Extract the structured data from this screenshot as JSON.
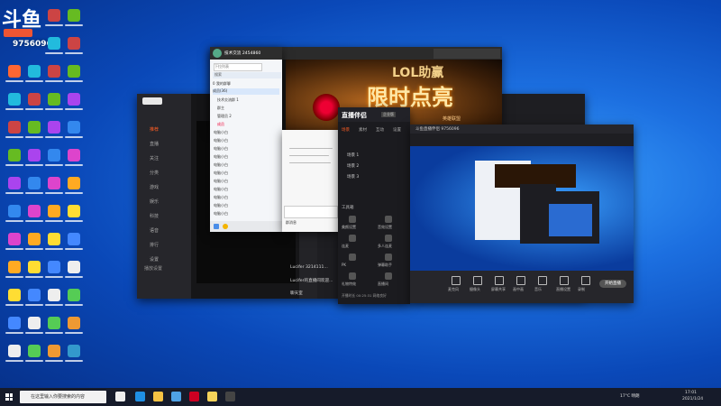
{
  "overlay": {
    "logo": "斗鱼",
    "room_number": "9756096"
  },
  "taskbar": {
    "search_placeholder": "在这里输入你要搜索的内容",
    "weather": "17°C 晴朗",
    "time": "17:01",
    "date": "2021/1/24"
  },
  "qq_window": {
    "title": "技术交流 2454860",
    "collapse": "下拉列表",
    "search_placeholder": "搜索",
    "group_label": "0 我的群聊",
    "members_title": "成员(36)",
    "members": [
      "技术交流群 1",
      "群主",
      "管理员 2",
      "成员",
      "电脑小白",
      "电脑小白",
      "电脑小白",
      "电脑小白",
      "电脑小白",
      "电脑小白",
      "电脑小白",
      "电脑小白",
      "电脑小白",
      "电脑小白",
      "电脑小白"
    ],
    "toolbar_label": "群消息"
  },
  "live_banner": {
    "brand": "LOL助赢",
    "headline": "限时点亮",
    "sub": "英雄联盟"
  },
  "douyu_window": {
    "sidebar": [
      "推荐",
      "直播",
      "关注",
      "分类",
      "游戏",
      "娱乐",
      "科技",
      "语音",
      "排行",
      "设置"
    ],
    "sidebar_bottom": "播放设置",
    "chat": [
      "Lucifer 3214111...",
      "Lucifer的直播间欢迎...",
      "聊天室"
    ]
  },
  "cast_panel": {
    "logo": "直播伴侣",
    "badge": "企业版",
    "tabs": [
      "场景",
      "素材",
      "互动",
      "设置"
    ],
    "scenes": [
      "场景 1",
      "场景 2",
      "场景 3"
    ],
    "tools_title": "工具箱",
    "tools": [
      "美颜设置",
      "音效设置",
      "连麦",
      "多人连麦",
      "PK",
      "弹幕助手",
      "礼物特效",
      "直播间"
    ],
    "footer": "开播时长 00:25:31 网络良好"
  },
  "preview_window": {
    "title": "斗鱼直播伴侣 9756096",
    "start_label": "开始直播",
    "controls": [
      "麦克风",
      "摄像头",
      "屏幕共享",
      "画中画",
      "音乐",
      "直播设置",
      "录制"
    ]
  },
  "colors": {
    "accent": "#ff5d23",
    "dark": "#1e1e22",
    "panel": "#2a2a30"
  }
}
